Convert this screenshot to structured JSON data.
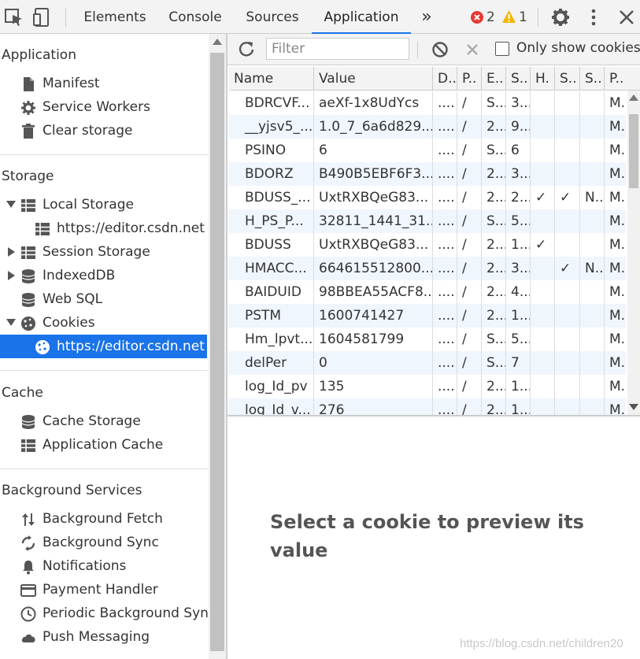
{
  "toolbar": {
    "tabs": [
      "Elements",
      "Console",
      "Sources",
      "Application"
    ],
    "more": "»",
    "errors": "2",
    "warnings": "1",
    "colors": {
      "error": "#e53935",
      "warning": "#f4b400",
      "accent": "#1a73e8"
    }
  },
  "sidebar": {
    "application_title": "Application",
    "manifest": "Manifest",
    "service_workers": "Service Workers",
    "clear_storage": "Clear storage",
    "storage_title": "Storage",
    "local_storage": "Local Storage",
    "local_storage_child": "https://editor.csdn.net",
    "session_storage": "Session Storage",
    "indexeddb": "IndexedDB",
    "web_sql": "Web SQL",
    "cookies": "Cookies",
    "cookies_child": "https://editor.csdn.net",
    "cache_title": "Cache",
    "cache_storage": "Cache Storage",
    "application_cache": "Application Cache",
    "bg_title": "Background Services",
    "bg_fetch": "Background Fetch",
    "bg_sync": "Background Sync",
    "notifications": "Notifications",
    "payment_handler": "Payment Handler",
    "periodic_sync": "Periodic Background Sync",
    "push_messaging": "Push Messaging"
  },
  "filter": {
    "placeholder": "Filter",
    "only_show": "Only show cookies w"
  },
  "table": {
    "headers": [
      "Name",
      "Value",
      "D..",
      "P..",
      "E..",
      "S..",
      "H.",
      "S..",
      "S..",
      "P.."
    ],
    "rows": [
      [
        "BDRCVF...",
        "aeXf-1x8UdYcs",
        "....",
        "/",
        "S...",
        "3...",
        "",
        "",
        "",
        "M..."
      ],
      [
        "__yjsv5_...",
        "1.0_7_6a6d829...",
        "....",
        "/",
        "2...",
        "9...",
        "",
        "",
        "",
        "M..."
      ],
      [
        "PSINO",
        "6",
        "....",
        "/",
        "S...",
        "6",
        "",
        "",
        "",
        "M..."
      ],
      [
        "BDORZ",
        "B490B5EBF6F3...",
        "....",
        "/",
        "2...",
        "3...",
        "",
        "",
        "",
        "M..."
      ],
      [
        "BDUSS_...",
        "UxtRXBQeG83...",
        "....",
        "/",
        "2...",
        "2...",
        "✓",
        "✓",
        "N...",
        "M..."
      ],
      [
        "H_PS_P...",
        "32811_1441_31...",
        "....",
        "/",
        "S...",
        "5...",
        "",
        "",
        "",
        "M..."
      ],
      [
        "BDUSS",
        "UxtRXBQeG83...",
        "....",
        "/",
        "2...",
        "1...",
        "✓",
        "",
        "",
        "M..."
      ],
      [
        "HMACC...",
        "664615512800...",
        "....",
        "/",
        "2...",
        "3...",
        "",
        "✓",
        "N...",
        "M..."
      ],
      [
        "BAIDUID",
        "98BBEA55ACF8...",
        "....",
        "/",
        "2...",
        "4...",
        "",
        "",
        "",
        "M..."
      ],
      [
        "PSTM",
        "1600741427",
        "....",
        "/",
        "2...",
        "1...",
        "",
        "",
        "",
        "M..."
      ],
      [
        "Hm_lpvt...",
        "1604581799",
        "....",
        "/",
        "S...",
        "5...",
        "",
        "",
        "",
        "M..."
      ],
      [
        "delPer",
        "0",
        "....",
        "/",
        "S...",
        "7",
        "",
        "",
        "",
        "M..."
      ],
      [
        "log_Id_pv",
        "135",
        "....",
        "/",
        "2...",
        "1...",
        "",
        "",
        "",
        "M..."
      ],
      [
        "log_Id_v...",
        "276",
        "....",
        "/",
        "2...",
        "1...",
        "",
        "",
        "",
        "M..."
      ]
    ]
  },
  "preview": {
    "message": "Select a cookie to preview its value"
  },
  "watermark": "https://blog.csdn.net/children20"
}
